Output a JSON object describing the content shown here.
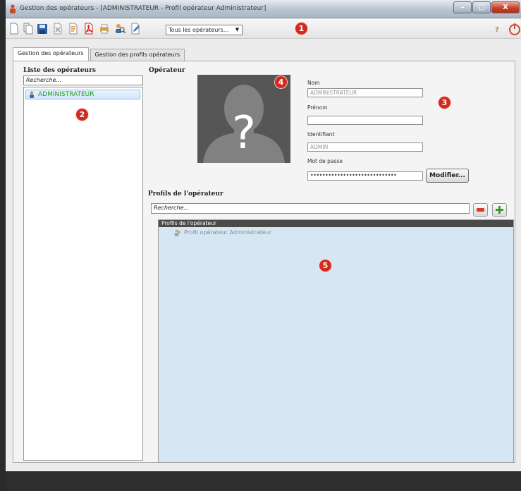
{
  "window": {
    "title": "Gestion des opérateurs - [ADMINISTRATEUR - Profil opérateur Administrateur]",
    "controls": {
      "minimize": "–",
      "maximize": "□",
      "close": "X"
    }
  },
  "toolbar": {
    "icons": [
      "new-icon",
      "copy-icon",
      "save-icon",
      "delete-icon",
      "export-icon",
      "pdf-icon",
      "print-icon",
      "search-user-icon",
      "edit-icon"
    ],
    "filter_select": "Tous les opérateurs...",
    "help": "?",
    "markers": {
      "m1": "1",
      "m2": "2",
      "m3": "3",
      "m4": "4",
      "m5": "5"
    }
  },
  "tabs": [
    {
      "label": "Gestion des opérateurs",
      "active": true
    },
    {
      "label": "Gestion des profils opérateurs",
      "active": false
    }
  ],
  "left": {
    "title": "Liste des opérateurs",
    "search_placeholder": "Recherche...",
    "items": [
      {
        "label": "ADMINISTRATEUR",
        "selected": true
      }
    ]
  },
  "operator": {
    "title": "Opérateur",
    "photo_symbol": "?",
    "fields": {
      "nom_label": "Nom",
      "nom_value": "ADMINISTRATEUR",
      "prenom_label": "Prénom",
      "prenom_value": "",
      "identifiant_label": "Identifiant",
      "identifiant_value": "ADMIN",
      "password_label": "Mot de passe",
      "password_value": "•••••••••••••••••••••••••••••"
    },
    "modify_button": "Modifier..."
  },
  "profiles": {
    "title": "Profils de l'opérateur",
    "search_placeholder": "Recherche...",
    "list_header": "Profils de l'opérateur",
    "items": [
      "Profil opérateur Administrateur"
    ]
  },
  "colors": {
    "marker": "#d32a1e",
    "selected_text": "#1aa31a",
    "profiles_bg": "#d6e7f3"
  }
}
